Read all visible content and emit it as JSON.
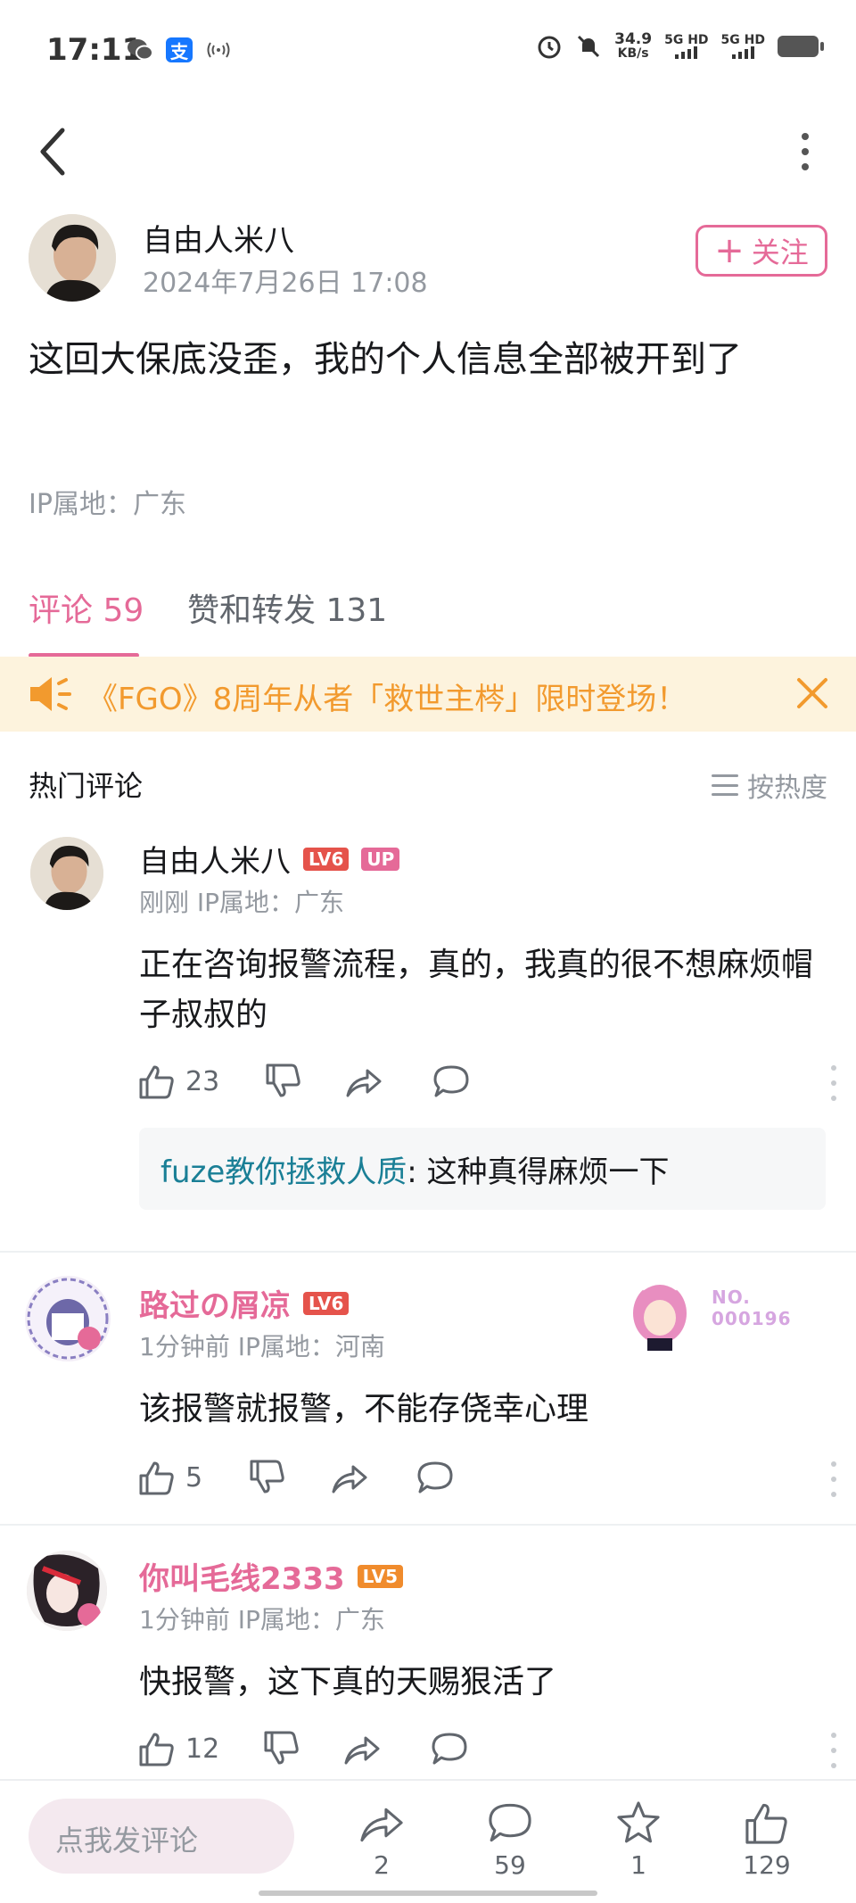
{
  "status": {
    "time": "17:11",
    "net_speed_value": "34.9",
    "net_speed_unit": "KB/s",
    "signal_1": "5G HD",
    "signal_2": "5G HD",
    "alipay_glyph": "支"
  },
  "post": {
    "author_name": "自由人米八",
    "datetime": "2024年7月26日 17:08",
    "follow_label": "关注",
    "follow_plus": "+",
    "text": "这回大保底没歪，我的个人信息全部被开到了",
    "ip_location": "IP属地：广东"
  },
  "tabs": [
    {
      "label": "评论 59",
      "active": true
    },
    {
      "label": "赞和转发 131",
      "active": false
    }
  ],
  "notice": {
    "text": "《FGO》8周年从者「救世主梣」限时登场！"
  },
  "hot_comments": {
    "title": "热门评论",
    "sort_label": "按热度"
  },
  "comments": [
    {
      "name": "自由人米八",
      "level": "LV6",
      "badge": "UP",
      "meta": "刚刚  IP属地：广东",
      "text": "正在咨询报警流程，真的，我真的很不想麻烦帽子叔叔的",
      "likes": "23",
      "reply_user": "fuze教你拯救人质",
      "reply_text": ": 这种真得麻烦一下"
    },
    {
      "name": "路过の屑凉",
      "level": "LV6",
      "meta": "1分钟前  IP属地：河南",
      "text": "该报警就报警，不能存侥幸心理",
      "likes": "5",
      "pendant_no_label": "NO.",
      "pendant_no_value": "000196"
    },
    {
      "name": "你叫毛线2333",
      "level": "LV5",
      "meta": "1分钟前  IP属地：广东",
      "text": "快报警，这下真的天赐狠活了",
      "likes": "12"
    }
  ],
  "bottom_bar": {
    "input_placeholder": "点我发评论",
    "share_count": "2",
    "comment_count": "59",
    "favorite_count": "1",
    "like_count": "129"
  },
  "colors": {
    "accent": "#e56a98",
    "notice_bg": "#fdf3dd",
    "notice_text": "#f29a2e",
    "muted": "#9499a0"
  }
}
